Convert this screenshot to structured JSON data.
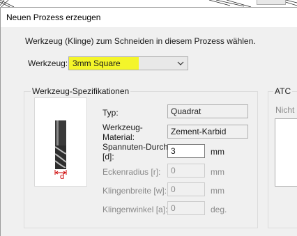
{
  "window": {
    "title": "Neuen Prozess erzeugen"
  },
  "instruction": "Werkzeug (Klinge) zum Schneiden in diesem Prozess wählen.",
  "tool_select": {
    "label": "Werkzeug:",
    "value": "3mm Square",
    "highlight_color": "#f4f52a"
  },
  "spec_group": {
    "title": "Werkzeug-Spezifikationen",
    "image_label": "d",
    "fields": [
      {
        "label": "Typ:",
        "value": "Quadrat",
        "unit": ""
      },
      {
        "label_line1": "Werkzeug-",
        "label_line2": "Material:",
        "value": "Zement-Karbid",
        "unit": ""
      },
      {
        "label_line1": "Spannuten-Durchr",
        "label_line2": "[d]:",
        "value": "3",
        "unit": "mm"
      },
      {
        "label": "Eckenradius [r]:",
        "value": "0",
        "unit": "mm"
      },
      {
        "label": "Klingenbreite [w]:",
        "value": "0",
        "unit": "mm"
      },
      {
        "label": "Klingenwinkel [a]:",
        "value": "0",
        "unit": "deg."
      }
    ]
  },
  "atc_group": {
    "title": "ATC",
    "text": "Nicht i"
  }
}
